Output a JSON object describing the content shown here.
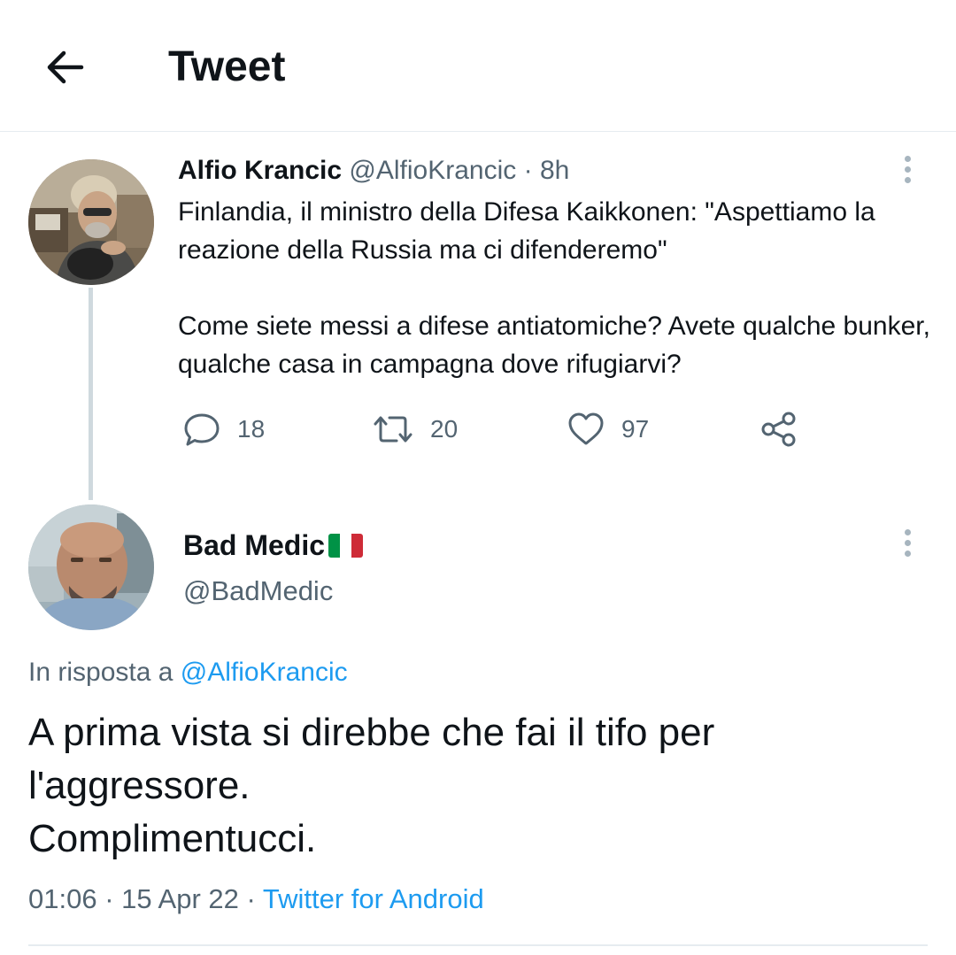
{
  "header": {
    "title": "Tweet",
    "back_icon": "arrow-left-icon"
  },
  "tweets": [
    {
      "author_name": "Alfio Krancic",
      "handle": "@AlfioKrancic",
      "separator": "·",
      "time": "8h",
      "paragraphs": [
        "Finlandia, il ministro della Difesa Kaikkonen: \"Aspettiamo la reazione della Russia ma ci difenderemo\"",
        "Come siete messi a difese antiatomiche? Avete qualche bunker, qualche casa in campagna dove rifugiarvi?"
      ],
      "actions": {
        "replies": "18",
        "retweets": "20",
        "likes": "97"
      }
    },
    {
      "author_name": "Bad Medic",
      "flag": "italian-flag-icon",
      "handle": "@BadMedic",
      "reply_prefix": "In risposta a",
      "reply_to": "@AlfioKrancic",
      "lines": [
        "A prima vista si direbbe che fai il tifo per",
        "l'aggressore.",
        "Complimentucci."
      ],
      "meta": {
        "time": "01:06",
        "sep1": "·",
        "date": "15 Apr 22",
        "sep2": "·",
        "source": "Twitter for Android"
      }
    }
  ],
  "colors": {
    "text": "#0f1419",
    "muted": "#536471",
    "link": "#1d9bf0",
    "divider": "#e6ecf0",
    "thread_line": "#cfd9de",
    "flag": [
      "#009246",
      "#ffffff",
      "#ce2b37"
    ]
  }
}
